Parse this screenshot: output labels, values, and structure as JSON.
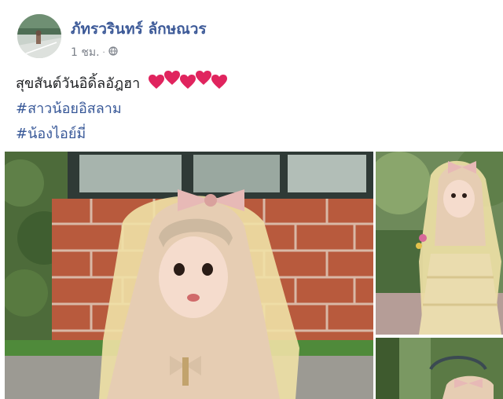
{
  "post": {
    "author": "ภัทรวรินทร์ ลักษณวร",
    "timestamp": "1 ชม.",
    "text": "สุขสันต์วันอิดิ้ลอัฎฮา",
    "emoji": [
      "heart-red",
      "heart-red",
      "heart-red",
      "heart-red",
      "heart-red"
    ],
    "hashtags": [
      "#สาวน้อยอิสลาม",
      "#น้องไอย์มี่"
    ],
    "colors": {
      "author": "#3d5a98",
      "hashtag": "#385898",
      "heart": "#e0245e"
    }
  }
}
